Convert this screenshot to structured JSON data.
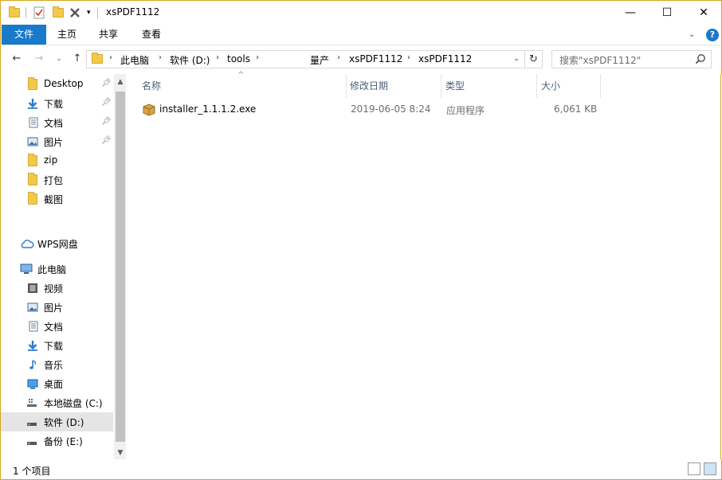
{
  "window": {
    "title": "xsPDF1112",
    "controls": {
      "minimize": "—",
      "maximize": "☐",
      "close": "✕"
    }
  },
  "ribbon": {
    "tabs": [
      "文件",
      "主页",
      "共享",
      "查看"
    ],
    "help": "?"
  },
  "address": {
    "crumbs": [
      "此电脑",
      "软件 (D:)",
      "tools",
      "量产",
      "xsPDF1112",
      "xsPDF1112"
    ],
    "search_placeholder": "搜索\"xsPDF1112\""
  },
  "nav": {
    "quick_access": [
      {
        "label": "Desktop",
        "icon": "folder-icon",
        "pinned": true
      },
      {
        "label": "下载",
        "icon": "download-icon",
        "pinned": true
      },
      {
        "label": "文档",
        "icon": "document-icon",
        "pinned": true
      },
      {
        "label": "图片",
        "icon": "picture-icon",
        "pinned": true
      },
      {
        "label": "zip",
        "icon": "folder-icon",
        "pinned": false
      },
      {
        "label": "打包",
        "icon": "folder-icon",
        "pinned": false
      },
      {
        "label": "截图",
        "icon": "folder-icon",
        "pinned": false
      }
    ],
    "wps": "WPS网盘",
    "this_pc": "此电脑",
    "pc_items": [
      {
        "label": "视频",
        "icon": "video-icon"
      },
      {
        "label": "图片",
        "icon": "picture-icon"
      },
      {
        "label": "文档",
        "icon": "document-icon"
      },
      {
        "label": "下载",
        "icon": "download-icon"
      },
      {
        "label": "音乐",
        "icon": "music-icon"
      },
      {
        "label": "桌面",
        "icon": "desktop-icon"
      },
      {
        "label": "本地磁盘 (C:)",
        "icon": "drive-icon"
      },
      {
        "label": "软件 (D:)",
        "icon": "drive-icon"
      },
      {
        "label": "备份 (E:)",
        "icon": "drive-icon"
      }
    ]
  },
  "columns": [
    "名称",
    "修改日期",
    "类型",
    "大小"
  ],
  "files": [
    {
      "name": "installer_1.1.1.2.exe",
      "modified": "2019-06-05 8:24",
      "type": "应用程序",
      "size": "6,061 KB"
    }
  ],
  "status": {
    "count": "1 个项目"
  },
  "colors": {
    "accent": "#1979ca",
    "selection": "#cce4f7",
    "frame": "#d9a520"
  }
}
